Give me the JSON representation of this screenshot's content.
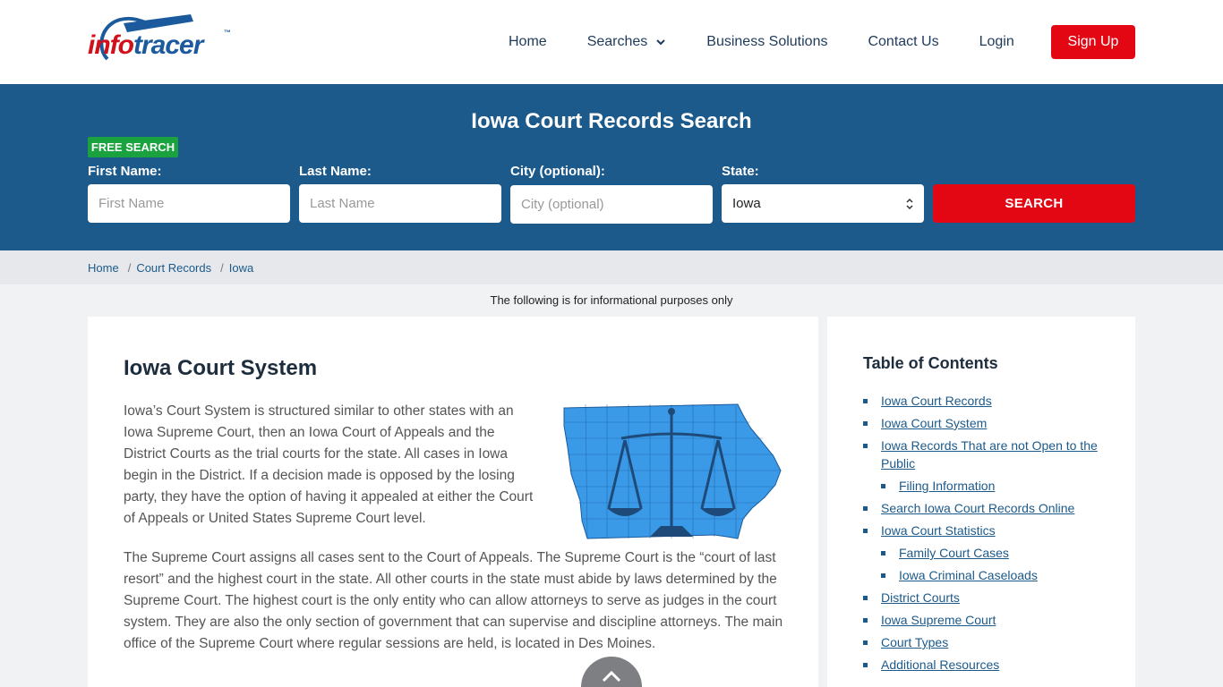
{
  "brand": {
    "info": "info",
    "tracer": "tracer",
    "tm": "™"
  },
  "nav": {
    "home": "Home",
    "searches": "Searches",
    "business": "Business Solutions",
    "contact": "Contact Us",
    "login": "Login",
    "signup": "Sign Up"
  },
  "hero": {
    "title": "Iowa Court Records Search",
    "badge": "FREE SEARCH",
    "first_label": "First Name:",
    "first_placeholder": "First Name",
    "last_label": "Last Name:",
    "last_placeholder": "Last Name",
    "city_label": "City (optional):",
    "city_placeholder": "City (optional)",
    "state_label": "State:",
    "state_value": "Iowa",
    "search_button": "SEARCH"
  },
  "breadcrumb": {
    "home": "Home",
    "sep": "/",
    "court": "Court Records",
    "current": "Iowa"
  },
  "info_note": "The following is for informational purposes only",
  "main": {
    "title": "Iowa Court System",
    "p1": "Iowa’s Court System is structured similar to other states with an Iowa Supreme Court, then an Iowa Court of Appeals and the District Courts as the trial courts for the state. All cases in Iowa begin in the District. If a decision made is opposed by the losing party, they have the option of having it appealed at either the Court of Appeals or United States Supreme Court level.",
    "p2": "The Supreme Court assigns all cases sent to the Court of Appeals. The Supreme Court is the “court of last resort” and the highest court in the state. All other courts in the state must abide by laws determined by the Supreme Court. The highest court is the only entity who can allow attorneys to serve as judges in the court system. They are also the only section of government that can supervise and discipline attorneys. The main office of the Supreme Court where regular sessions are held, is located in Des Moines."
  },
  "toc": {
    "title": "Table of Contents",
    "items": [
      {
        "label": "Iowa Court Records",
        "sub": false
      },
      {
        "label": "Iowa Court System",
        "sub": false
      },
      {
        "label": "Iowa Records That are not Open to the Public",
        "sub": false
      },
      {
        "label": "Filing Information",
        "sub": true
      },
      {
        "label": "Search Iowa Court Records Online",
        "sub": false
      },
      {
        "label": "Iowa Court Statistics",
        "sub": false
      },
      {
        "label": "Family Court Cases",
        "sub": true
      },
      {
        "label": "Iowa Criminal Caseloads",
        "sub": true
      },
      {
        "label": "District Courts",
        "sub": false
      },
      {
        "label": "Iowa Supreme Court",
        "sub": false
      },
      {
        "label": "Court Types",
        "sub": false
      },
      {
        "label": "Additional Resources",
        "sub": false
      }
    ]
  },
  "colors": {
    "brand_blue": "#1c5a8b",
    "accent_red": "#e30613",
    "badge_green": "#19a23e"
  },
  "icons": {
    "searches_chevron": "chevron-down-icon",
    "scroll_top": "chevron-up-icon",
    "map": "iowa-map-scales-icon"
  }
}
